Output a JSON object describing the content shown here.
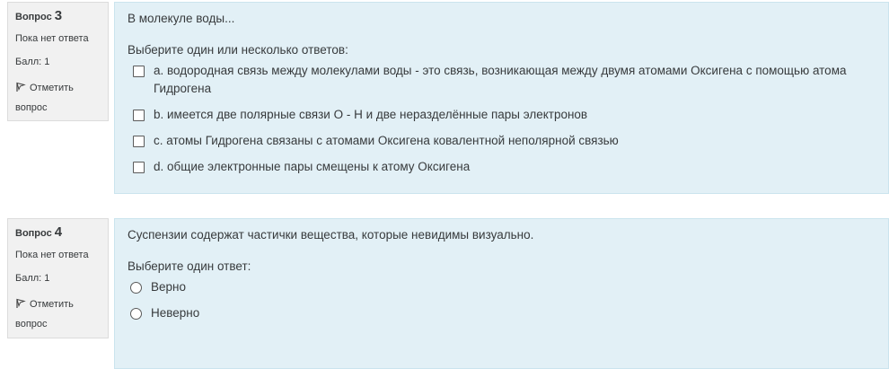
{
  "questions": [
    {
      "label": "Вопрос",
      "number": "3",
      "state": "Пока нет ответа",
      "grade": "Балл: 1",
      "flag": "Отметить вопрос",
      "text": "В молекуле воды...",
      "prompt": "Выберите один или несколько ответов:",
      "options": [
        "a. водородная связь между молекулами воды - это связь, возникающая между двумя атомами Оксигена с помощью атома Гидрогена",
        "b. имеется две полярные связи О - Н и две неразделённые пары электронов",
        "c. атомы Гидрогена связаны с атомами Оксигена ковалентной неполярной связью",
        "d. общие электронные пары смещены к атому Оксигена"
      ]
    },
    {
      "label": "Вопрос",
      "number": "4",
      "state": "Пока нет ответа",
      "grade": "Балл: 1",
      "flag": "Отметить вопрос",
      "text": "Суспензии содержат частички вещества, которые невидимы визуально.",
      "prompt": "Выберите один ответ:",
      "options": [
        "Верно",
        "Неверно"
      ]
    }
  ],
  "icons": {
    "flag": "flag-icon",
    "checkbox": "checkbox-icon",
    "radio": "radio-icon"
  },
  "colors": {
    "content_bg": "#e2f0f6",
    "info_bg": "#f1f1f1"
  }
}
